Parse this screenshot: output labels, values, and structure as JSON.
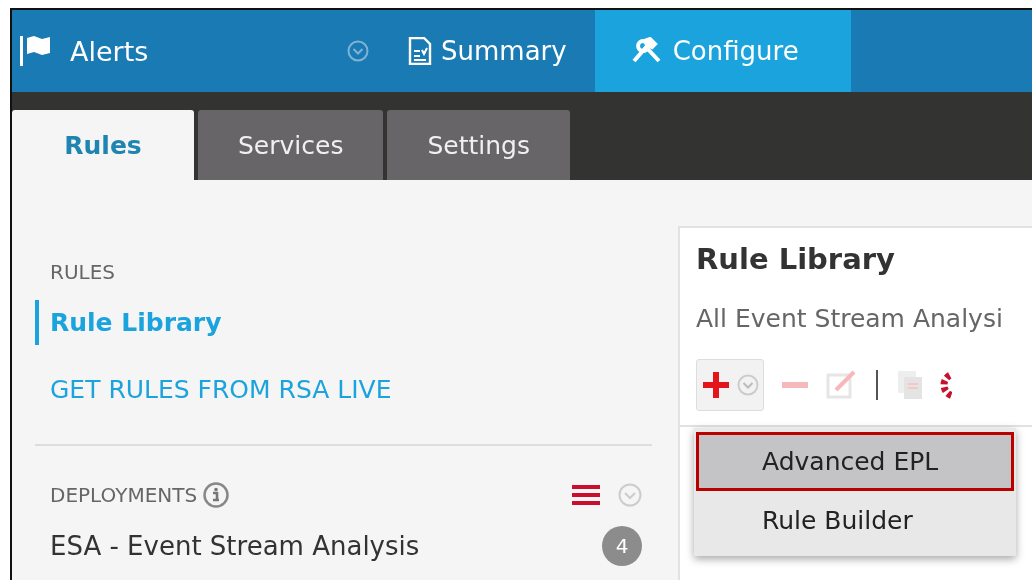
{
  "nav": {
    "app": "Alerts",
    "items": [
      {
        "label": "Summary",
        "selected": false,
        "kind": "summary"
      },
      {
        "label": "Configure",
        "selected": true,
        "kind": "configure"
      }
    ]
  },
  "tabs": [
    {
      "label": "Rules",
      "selected": true
    },
    {
      "label": "Services",
      "selected": false
    },
    {
      "label": "Settings",
      "selected": false
    }
  ],
  "sidebar": {
    "rules_heading": "RULES",
    "items": [
      {
        "label": "Rule Library",
        "selected": true
      },
      {
        "label": "GET RULES FROM RSA LIVE",
        "selected": false
      }
    ],
    "deployments_heading": "DEPLOYMENTS",
    "deployments": [
      {
        "name": "ESA - Event Stream Analysis",
        "count": "4"
      }
    ]
  },
  "library": {
    "title": "Rule Library",
    "subtitle": "All Event Stream Analysi",
    "menu": [
      {
        "label": "Advanced EPL",
        "selected": true
      },
      {
        "label": "Rule Builder",
        "selected": false
      }
    ]
  }
}
